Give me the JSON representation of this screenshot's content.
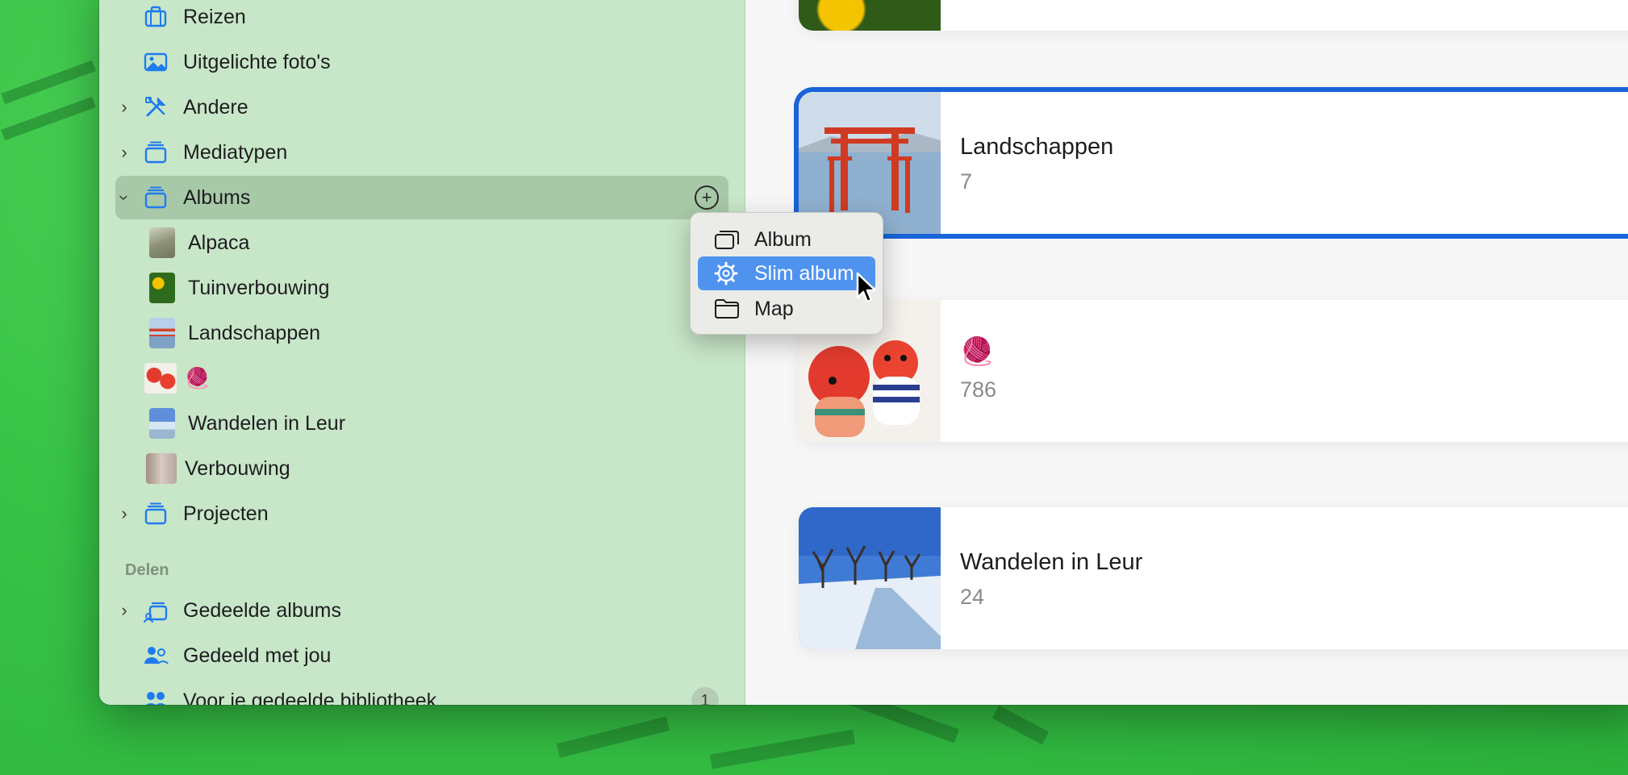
{
  "sidebar": {
    "items": [
      {
        "label": "Reizen",
        "icon": "suitcase-icon"
      },
      {
        "label": "Uitgelichte foto's",
        "icon": "photo-icon"
      },
      {
        "label": "Andere",
        "icon": "tools-icon"
      },
      {
        "label": "Mediatypen",
        "icon": "stack-icon"
      },
      {
        "label": "Albums",
        "icon": "stack-icon",
        "add_label": "+"
      },
      {
        "label": "Projecten",
        "icon": "stack-icon"
      }
    ],
    "albums": [
      {
        "label": "Alpaca"
      },
      {
        "label": "Tuinverbouwing"
      },
      {
        "label": "Landschappen"
      },
      {
        "label": "🧶"
      },
      {
        "label": "Wandelen in Leur"
      },
      {
        "label": "Verbouwing"
      }
    ],
    "section_delen": "Delen",
    "shared": [
      {
        "label": "Gedeelde albums",
        "icon": "shared-albums-icon"
      },
      {
        "label": "Gedeeld met jou",
        "icon": "shared-people-icon"
      },
      {
        "label": "Voor je gedeelde bibliotheek",
        "icon": "people-icon",
        "badge": "1"
      }
    ]
  },
  "context_menu": {
    "items": [
      {
        "label": "Album",
        "icon": "album-icon"
      },
      {
        "label": "Slim album",
        "icon": "gear-icon",
        "highlighted": true
      },
      {
        "label": "Map",
        "icon": "folder-icon"
      }
    ]
  },
  "albums_grid": [
    {
      "title": "Landschappen",
      "count": "7",
      "selected": true
    },
    {
      "title": "🧶",
      "count": "786"
    },
    {
      "title": "Wandelen in Leur",
      "count": "24"
    }
  ],
  "colors": {
    "accent": "#1864d8",
    "menu_highlight": "#4f93ef",
    "sidebar_bg": "#c8e6c8",
    "desktop_bg": "#38c447"
  }
}
